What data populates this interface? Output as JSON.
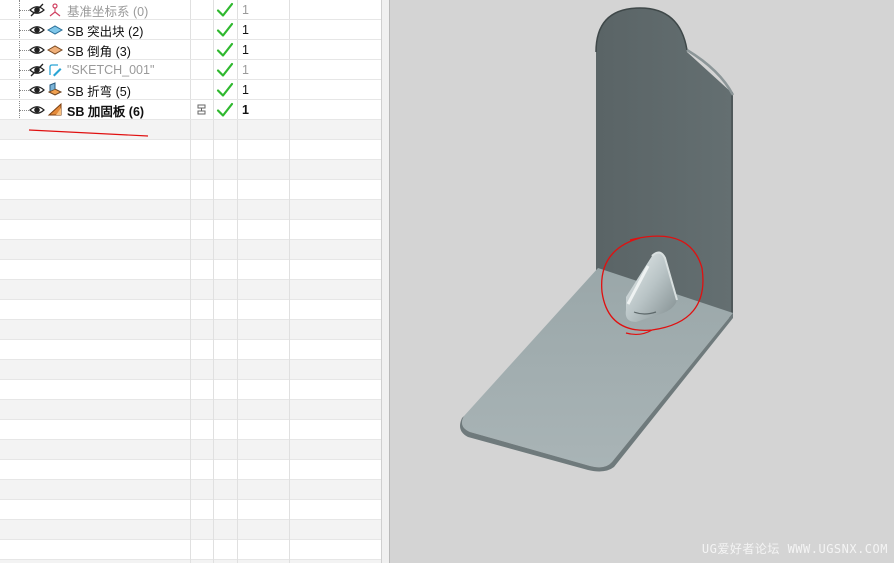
{
  "navigator": {
    "features": [
      {
        "name": "基准坐标系 (0)",
        "icon": "datum-csys-icon",
        "eye": "hidden-eye-icon",
        "check": "check-icon",
        "value": "1",
        "state": "dim"
      },
      {
        "name": "SB 突出块 (2)",
        "icon": "tab-feature-icon",
        "eye": "eye-icon",
        "check": "check-icon",
        "value": "1",
        "state": "normal"
      },
      {
        "name": "SB 倒角 (3)",
        "icon": "chamfer-feature-icon",
        "eye": "eye-icon",
        "check": "check-icon",
        "value": "1",
        "state": "normal"
      },
      {
        "name": "\"SKETCH_001\"",
        "icon": "sketch-icon",
        "eye": "hidden-eye-icon",
        "check": "check-icon",
        "value": "1",
        "state": "dim"
      },
      {
        "name": "SB 折弯 (5)",
        "icon": "bend-feature-icon",
        "eye": "eye-icon",
        "check": "check-icon",
        "value": "1",
        "state": "normal"
      },
      {
        "name": "SB 加固板 (6)",
        "icon": "gusset-feature-icon",
        "eye": "eye-icon",
        "check": "check-icon",
        "value": "1",
        "state": "current"
      }
    ]
  },
  "viewport": {
    "watermark": "UG爱好者论坛 WWW.UGSNX.COM",
    "model": "sheet-metal-bracket-with-gusset"
  },
  "colors": {
    "viewport_bg": "#d4d4d4",
    "check_green": "#2fb82f",
    "annotation_red": "#e01010",
    "part_face_vertical": "#5f6a6c",
    "part_face_base": "#a4b0b2"
  }
}
